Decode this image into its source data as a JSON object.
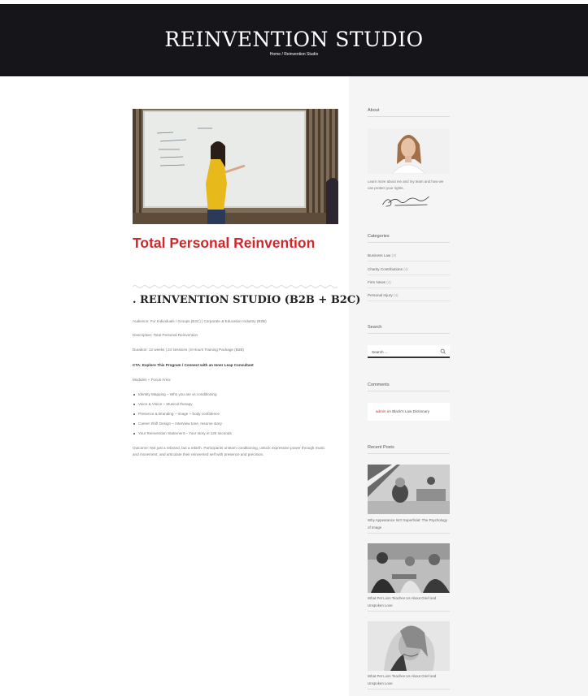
{
  "header": {
    "site_title": "REINVENTION STUDIO",
    "breadcrumb": "Home / Reinvention Studio"
  },
  "post": {
    "title": "Total Personal Reinvention",
    "section_heading": ". REINVENTION STUDIO (B2B + B2C)",
    "audience": "Audience: For Individuals / Groups (B2C) | Corporate & Education Industry (B2B)",
    "description": "Description: Total Personal Reinvention",
    "duration": "Duration: 12 weeks | 24 sessions | 8 Hours Training Package (B2B)",
    "cta": "CTA: Explore This Program / Connect with an Inner Leap Consultant",
    "modules_label": "Modules + Focus Area:",
    "modules": [
      "Identity Mapping – Who you are vs conditioning",
      "Voice & Vision – Musical therapy",
      "Presence & Branding – Image + body confidence",
      "Career Shift Design – Interview tone, resume story",
      "Your Reinvention Statement – Your story in 120 seconds"
    ],
    "outcome": "Outcome: Not just a rebrand, but a rebirth. Participants unlearn conditioning, unlock expressive power through music and movement, and articulate their reinvented self with presence and precision."
  },
  "sidebar": {
    "about": {
      "title": "About",
      "text": "Learn more about me and my team and how we can protect your rights."
    },
    "categories": {
      "title": "Categories",
      "items": [
        {
          "label": "Business Law",
          "count": "(3)"
        },
        {
          "label": "Charity Contributions",
          "count": "(4)"
        },
        {
          "label": "Firm News",
          "count": "(4)"
        },
        {
          "label": "Personal Injury",
          "count": "(4)"
        }
      ]
    },
    "search": {
      "title": "Search",
      "placeholder": "Search ..."
    },
    "comments": {
      "title": "Comments",
      "author": "admin",
      "on": " on ",
      "post": "Black's Law Dictionary"
    },
    "recent_posts": {
      "title": "Recent Posts",
      "items": [
        "Why Appearance Isn't Superficial: The Psychology of Image",
        "What Pet Loss Teaches Us About Grief and Unspoken Love",
        "What Pet Loss Teaches Us About Grief and Unspoken Love"
      ]
    }
  },
  "colors": {
    "hero_bg": "#16151a",
    "accent": "#d1272a",
    "sidebar_bg": "#f5f5f5"
  }
}
